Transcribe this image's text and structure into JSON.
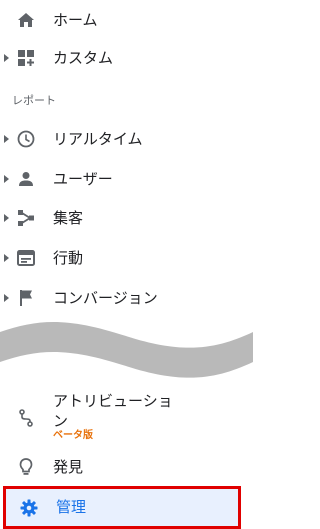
{
  "nav": {
    "home": {
      "label": "ホーム",
      "icon": "home-icon"
    },
    "custom": {
      "label": "カスタム",
      "icon": "dashboard-add-icon"
    },
    "reports_section": "レポート",
    "realtime": {
      "label": "リアルタイム",
      "icon": "clock-icon"
    },
    "audience": {
      "label": "ユーザー",
      "icon": "person-icon"
    },
    "acquisition": {
      "label": "集客",
      "icon": "acquisition-icon"
    },
    "behavior": {
      "label": "行動",
      "icon": "behavior-icon"
    },
    "conversions": {
      "label": "コンバージョン",
      "icon": "flag-icon"
    },
    "attribution": {
      "label": "アトリビューション",
      "badge": "ベータ版",
      "icon": "attribution-icon"
    },
    "discover": {
      "label": "発見",
      "icon": "lightbulb-icon"
    },
    "admin": {
      "label": "管理",
      "icon": "gear-icon"
    }
  },
  "colors": {
    "icon_gray": "#5f6368",
    "text": "#202124",
    "accent_blue": "#1a73e8",
    "beta_orange": "#e8710a",
    "highlight_red": "#e00000",
    "selected_bg": "#e8f0fe"
  }
}
